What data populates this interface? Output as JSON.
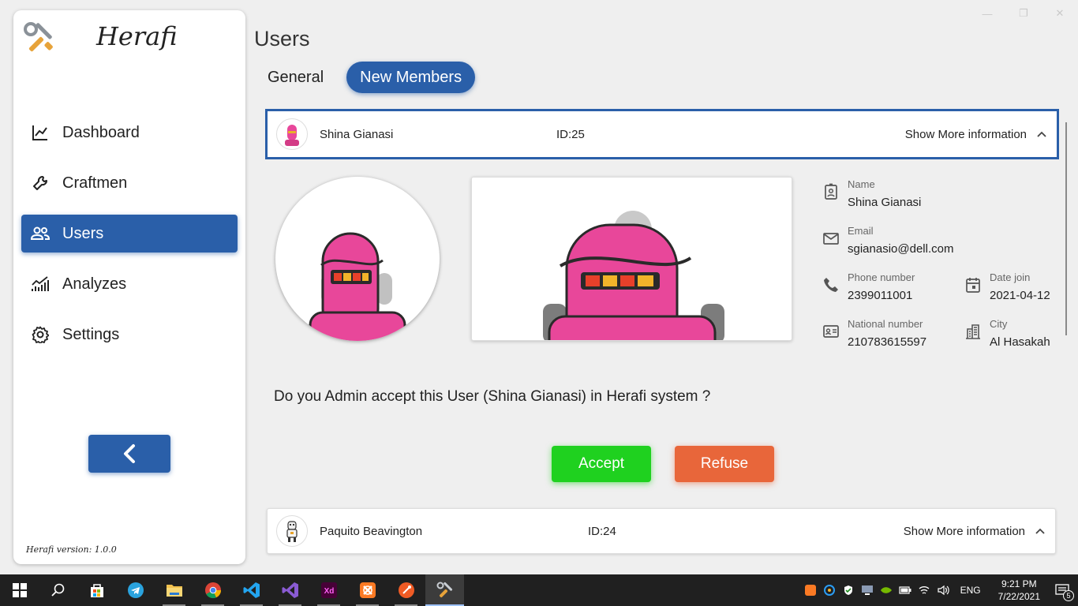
{
  "app": {
    "name": "Herafi",
    "version_label": "Herafi version: 1.0.0"
  },
  "sidebar": {
    "items": [
      {
        "label": "Dashboard",
        "icon": "chart-line-icon",
        "active": false
      },
      {
        "label": "Craftmen",
        "icon": "wrench-icon",
        "active": false
      },
      {
        "label": "Users",
        "icon": "users-icon",
        "active": true
      },
      {
        "label": "Analyzes",
        "icon": "analytics-icon",
        "active": false
      },
      {
        "label": "Settings",
        "icon": "gear-icon",
        "active": false
      }
    ],
    "back_icon": "chevron-left-icon"
  },
  "main": {
    "title": "Users",
    "tabs": [
      {
        "label": "General",
        "active": false
      },
      {
        "label": "New Members",
        "active": true
      }
    ],
    "selected_user": {
      "name": "Shina Gianasi",
      "id_label": "ID:25",
      "more_label": "Show More information",
      "details": {
        "name": {
          "label": "Name",
          "value": "Shina Gianasi"
        },
        "email": {
          "label": "Email",
          "value": "sgianasio@dell.com"
        },
        "phone": {
          "label": "Phone number",
          "value": "2399011001"
        },
        "date_join": {
          "label": "Date join",
          "value": "2021-04-12"
        },
        "national": {
          "label": "National number",
          "value": "210783615597"
        },
        "city": {
          "label": "City",
          "value": "Al Hasakah"
        }
      },
      "question": "Do you Admin accept this User (Shina Gianasi) in Herafi system ?",
      "accept_label": "Accept",
      "refuse_label": "Refuse"
    },
    "next_user": {
      "name": "Paquito Beavington",
      "id_label": "ID:24",
      "more_label": "Show More information"
    }
  },
  "colors": {
    "primary": "#2a5fa9",
    "accept": "#1fd11f",
    "refuse": "#e8663a",
    "avatar_pink": "#e8479a"
  },
  "taskbar": {
    "apps": [
      "windows-start-icon",
      "search-icon",
      "store-icon",
      "telegram-icon",
      "file-explorer-icon",
      "chrome-icon",
      "vscode-icon",
      "visual-studio-icon",
      "adobe-xd-icon",
      "xampp-icon",
      "postman-icon",
      "herafi-app-icon"
    ],
    "lang": "ENG",
    "time": "9:21 PM",
    "date": "7/22/2021",
    "notifications": "5"
  }
}
